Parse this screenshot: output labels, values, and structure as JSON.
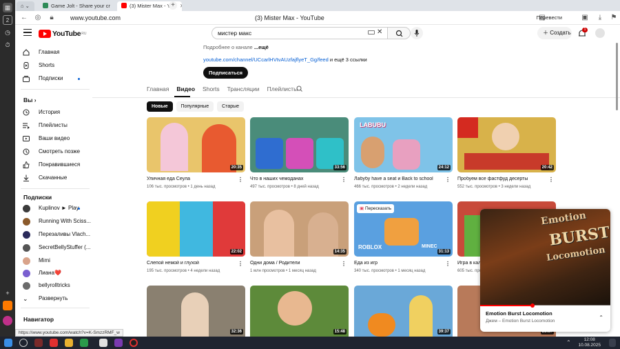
{
  "browser": {
    "tabs": [
      {
        "label": "Game Jolt - Share your cr",
        "active": false
      },
      {
        "label": "(3) Mister Max - You",
        "active": true
      }
    ],
    "url": "www.youtube.com",
    "page_title": "(3) Mister Max - YouTube",
    "translate_label": "Перевести",
    "status_url": "https://www.youtube.com/watch?v=K-SmzzRMF_w"
  },
  "header": {
    "logo_text": "YouTube",
    "logo_region": "RU",
    "search_value": "мистер макс",
    "create_label": "Создать",
    "notification_count": "1"
  },
  "sidebar": {
    "main_items": [
      {
        "label": "Главная",
        "icon": "home-icon"
      },
      {
        "label": "Shorts",
        "icon": "shorts-icon"
      },
      {
        "label": "Подписки",
        "icon": "subscriptions-icon"
      }
    ],
    "you_heading": "Вы",
    "you_items": [
      {
        "label": "История",
        "icon": "history-icon"
      },
      {
        "label": "Плейлисты",
        "icon": "playlists-icon"
      },
      {
        "label": "Ваши видео",
        "icon": "your-videos-icon"
      },
      {
        "label": "Смотреть позже",
        "icon": "watch-later-icon"
      },
      {
        "label": "Понравившиеся",
        "icon": "liked-icon"
      },
      {
        "label": "Скачанные",
        "icon": "downloads-icon"
      }
    ],
    "subs_heading": "Подписки",
    "subscriptions": [
      {
        "label": "Kuplinov ► Play",
        "color": "#3b3b3b",
        "new": true
      },
      {
        "label": "Running With Sciss...",
        "color": "#8b5a2b",
        "new": false
      },
      {
        "label": "Перезаливы Vlach...",
        "color": "#2a2a5a",
        "new": false
      },
      {
        "label": "SecretBellyStuffer (...",
        "color": "#555555",
        "new": false
      },
      {
        "label": "Mimi",
        "color": "#d9a38a",
        "new": false
      },
      {
        "label": "Лиана❤️",
        "color": "#7a5fd0",
        "new": false
      },
      {
        "label": "bellyrolltricks",
        "color": "#6b6b6b",
        "new": false
      }
    ],
    "expand_label": "Развернуть",
    "navigator_heading": "Навигатор"
  },
  "channel": {
    "about_prefix": "Подробнее о канале",
    "about_more": "...ещё",
    "link": "youtube.com/channel/UCcarlHVtvAUzfajflyeT_Gg/feed",
    "link_suffix": "и ещё 3 ссылки",
    "subscribe_label": "Подписаться",
    "tabs": [
      "Главная",
      "Видео",
      "Shorts",
      "Трансляции",
      "Плейлисты"
    ],
    "active_tab": "Видео",
    "chips": [
      "Новые",
      "Популярные",
      "Старые"
    ],
    "active_chip": "Новые"
  },
  "videos": [
    {
      "title": "Уличная еда Сеула",
      "views": "106 тыс. просмотров",
      "age": "1 день назад",
      "duration": "20:35",
      "color": "#e9c56b"
    },
    {
      "title": "Что в наших чемоданах",
      "views": "497 тыс. просмотров",
      "age": "8 дней назад",
      "duration": "33:56",
      "color": "#4a8c7a"
    },
    {
      "title": "Лабубу have a seat и Back to school",
      "views": "466 тыс. просмотров",
      "age": "2 недели назад",
      "duration": "24:12",
      "color": "#7fc3e8"
    },
    {
      "title": "Пробуем все фастфуд десерты",
      "views": "552 тыс. просмотров",
      "age": "3 недели назад",
      "duration": "20:42",
      "color": "#d8b24a"
    },
    {
      "title": "Слепой немой и глухой",
      "views": "195 тыс. просмотров",
      "age": "4 недели назад",
      "duration": "22:02",
      "color": "#e04a3a"
    },
    {
      "title": "Одни дома / Родители",
      "views": "1 млн просмотров",
      "age": "1 месяц назад",
      "duration": "14:35",
      "color": "#c9a07a"
    },
    {
      "title": "Еда из игр",
      "views": "340 тыс. просмотров",
      "age": "1 месяц назад",
      "duration": "31:13",
      "color": "#5aa0e0"
    },
    {
      "title": "Игра в кал",
      "views": "605 тыс. просмотров",
      "age": "",
      "duration": "",
      "color": "#c84a3a"
    },
    {
      "title": "",
      "views": "",
      "age": "",
      "duration": "32:36",
      "color": "#8a8070"
    },
    {
      "title": "",
      "views": "",
      "age": "",
      "duration": "15:48",
      "color": "#5d8a3a"
    },
    {
      "title": "",
      "views": "",
      "age": "",
      "duration": "39:37",
      "color": "#6aa8d8"
    },
    {
      "title": "",
      "views": "",
      "age": "",
      "duration": "21:37",
      "color": "#b87a5a"
    }
  ],
  "thumb_labels": {
    "labubu": "LABUBU",
    "retell": "Пересказать",
    "roblox": "ROBLOX",
    "minecraft": "MINEC"
  },
  "miniplayer": {
    "title": "Emotion Burst Locomotion",
    "subtitle": "Джем – Emotion Burst Locomotion",
    "art_text_1": "Emotion",
    "art_text_2": "BURST!",
    "art_text_3": "Locomotion",
    "progress": 0.4
  },
  "taskbar": {
    "time": "12:08",
    "date": "10.08.2025"
  }
}
